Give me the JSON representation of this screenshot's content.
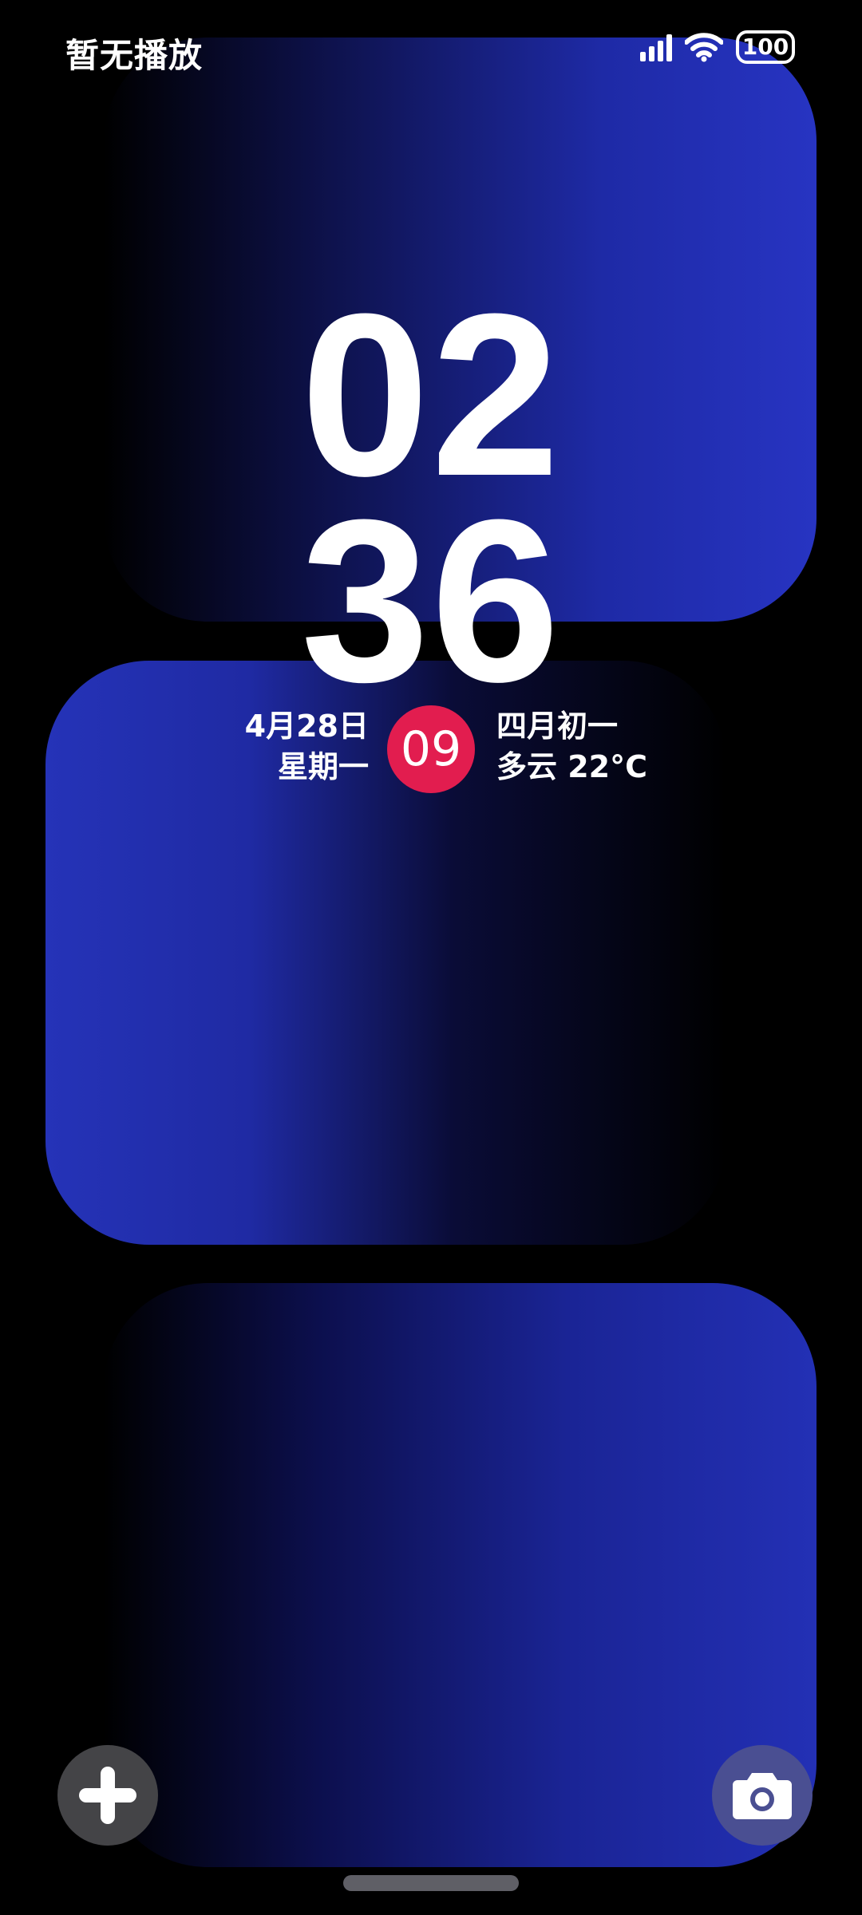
{
  "status_bar": {
    "media_text": "暂无播放",
    "battery_level": "100",
    "signal_icon": "signal-bars-icon",
    "wifi_icon": "wifi-icon"
  },
  "clock": {
    "hour": "02",
    "minute": "36"
  },
  "date_widget": {
    "date": "4月28日",
    "weekday": "星期一",
    "badge_number": "09",
    "lunar_date": "四月初一",
    "weather": "多云 22°C"
  },
  "shortcuts": {
    "left_icon": "plus-icon",
    "right_icon": "camera-icon"
  },
  "colors": {
    "badge": "#e21d4f",
    "wallpaper_blue": "#2734c2"
  }
}
